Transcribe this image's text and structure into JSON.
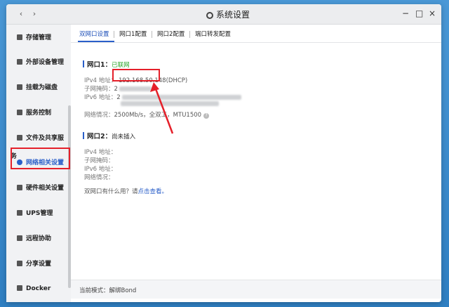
{
  "window": {
    "title": "系统设置",
    "nav_back": "‹",
    "nav_forward": "›",
    "ctl_minimize": "−",
    "ctl_maximize": "□",
    "ctl_close": "×"
  },
  "sidebar": {
    "items": [
      {
        "label": "存储管理",
        "icon": "storage-icon"
      },
      {
        "label": "外部设备管理",
        "icon": "usb-icon"
      },
      {
        "label": "挂载为磁盘",
        "icon": "mount-icon"
      },
      {
        "label": "服务控制",
        "icon": "toggle-icon"
      },
      {
        "label": "文件及共享服务",
        "icon": "folder-icon"
      },
      {
        "label": "网络相关设置",
        "icon": "network-icon",
        "active": true
      },
      {
        "label": "硬件相关设置",
        "icon": "grid-icon"
      },
      {
        "label": "UPS管理",
        "icon": "ups-icon"
      },
      {
        "label": "远程协助",
        "icon": "remote-icon"
      },
      {
        "label": "分享设置",
        "icon": "share-icon"
      },
      {
        "label": "Docker",
        "icon": "docker-icon"
      }
    ]
  },
  "tabs": [
    {
      "label": "双网口设置",
      "active": true
    },
    {
      "label": "网口1配置"
    },
    {
      "label": "网口2配置"
    },
    {
      "label": "端口转发配置"
    }
  ],
  "port1": {
    "title": "网口1：",
    "status": "已联网",
    "ipv4_label": "IPv4 地址：",
    "ipv4_value": "192.168.50.148(DHCP)",
    "mask_label": "子网掩码：",
    "mask_value": "2",
    "ipv6_label": "IPv6 地址：",
    "ipv6_value": "2",
    "net_label": "网络情况：",
    "net_value": "2500Mb/s，全双工，MTU1500"
  },
  "port2": {
    "title": "网口2：",
    "status": "尚未插入",
    "ipv4_label": "IPv4 地址：",
    "mask_label": "子网掩码：",
    "ipv6_label": "IPv6 地址：",
    "net_label": "网络情况：",
    "help_text": "双网口有什么用？请",
    "help_link": "点击查看。"
  },
  "footer": {
    "mode_label": "当前模式：",
    "mode_value": "解绑Bond"
  },
  "colors": {
    "accent": "#2a5fc9",
    "online": "#2aa52a",
    "annotation": "#e5202a"
  }
}
